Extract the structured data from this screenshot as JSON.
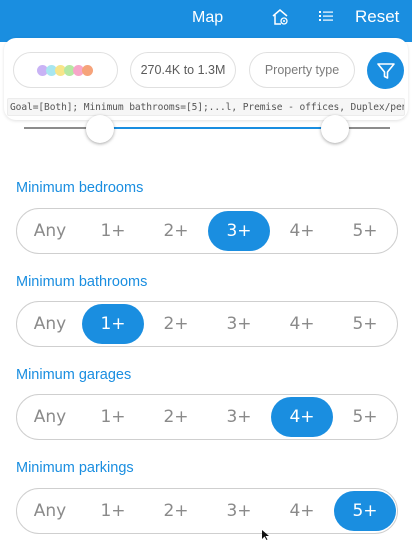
{
  "topbar": {
    "map_label": "Map",
    "reset_label": "Reset",
    "icons": [
      "home-settings-icon",
      "list-icon"
    ]
  },
  "filters": {
    "color_dots": [
      "#c9b3f5",
      "#a8e6f0",
      "#f7e58a",
      "#b6e8a3",
      "#f7a6c9",
      "#f6a37a"
    ],
    "price_range": "270.4K to 1.3M",
    "property_type_placeholder": "Property type",
    "summary": "Goal=[Both]; Minimum bathrooms=[5];...l, Premise - offices, Duplex/penthouse, ..."
  },
  "slider": {
    "min_fraction": 0.21,
    "max_fraction": 0.85
  },
  "sections": [
    {
      "title": "Minimum bedrooms",
      "options": [
        "Any",
        "1+",
        "2+",
        "3+",
        "4+",
        "5+"
      ],
      "selected": 3
    },
    {
      "title": "Minimum bathrooms",
      "options": [
        "Any",
        "1+",
        "2+",
        "3+",
        "4+",
        "5+"
      ],
      "selected": 1
    },
    {
      "title": "Minimum garages",
      "options": [
        "Any",
        "1+",
        "2+",
        "3+",
        "4+",
        "5+"
      ],
      "selected": 4
    },
    {
      "title": "Minimum parkings",
      "options": [
        "Any",
        "1+",
        "2+",
        "3+",
        "4+",
        "5+"
      ],
      "selected": 5
    }
  ],
  "colors": {
    "accent": "#1a8ee0"
  }
}
